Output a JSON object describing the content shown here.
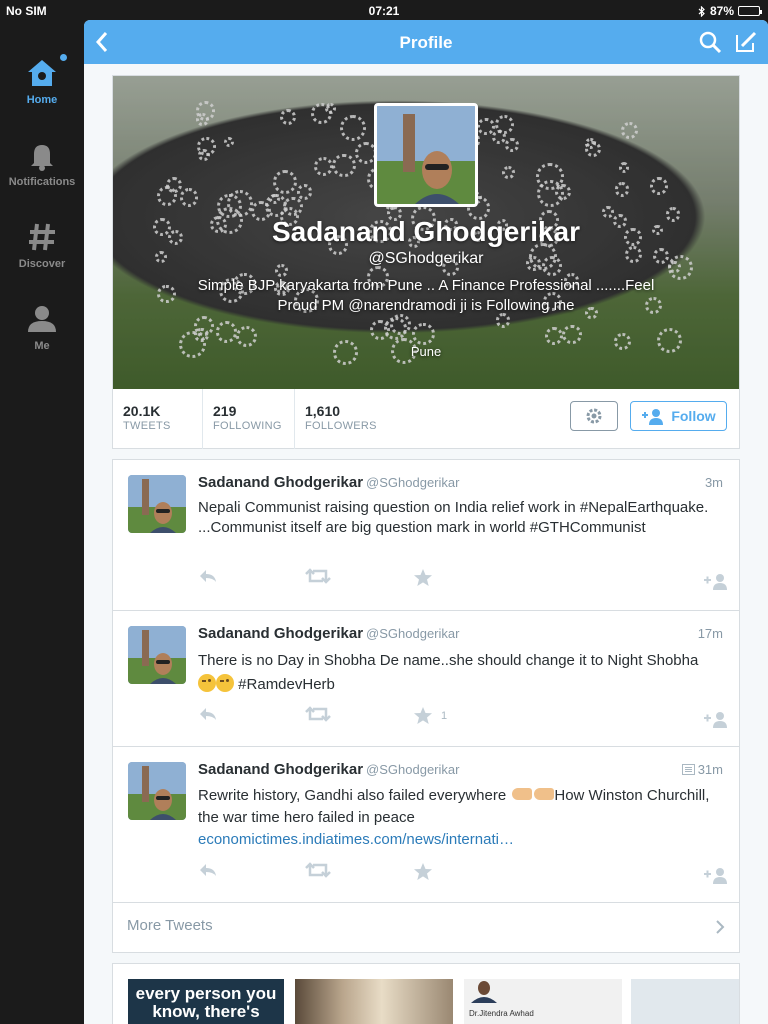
{
  "status_bar": {
    "carrier": "No SIM",
    "time": "07:21",
    "battery": "87%",
    "battery_level": 0.87
  },
  "sidebar": {
    "items": [
      {
        "label": "Home",
        "icon": "home-icon",
        "active": true
      },
      {
        "label": "Notifications",
        "icon": "bell-icon",
        "active": false
      },
      {
        "label": "Discover",
        "icon": "hashtag-icon",
        "active": false
      },
      {
        "label": "Me",
        "icon": "person-icon",
        "active": false
      }
    ]
  },
  "navbar": {
    "title": "Profile"
  },
  "profile": {
    "name": "Sadanand Ghodgerikar",
    "handle": "@SGhodgerikar",
    "bio": "Simple BJP karyakarta from Pune .. A Finance Professional .......Feel Proud PM @narendramodi ji is Following me",
    "location": "Pune",
    "stats": [
      {
        "value": "20.1K",
        "label": "TWEETS"
      },
      {
        "value": "219",
        "label": "FOLLOWING"
      },
      {
        "value": "1,610",
        "label": "FOLLOWERS"
      }
    ],
    "follow_label": "Follow"
  },
  "tweets": [
    {
      "name": "Sadanand Ghodgerikar",
      "handle": "@SGhodgerikar",
      "time": "3m",
      "text": "Nepali Communist raising question on India relief work in #NepalEarthquake. ...Communist itself are big question mark in world #GTHCommunist",
      "favorites": ""
    },
    {
      "name": "Sadanand Ghodgerikar",
      "handle": "@SGhodgerikar",
      "time": "17m",
      "text_before": "There is no Day in Shobha De name..she should change it to Night Shobha",
      "text_after": "#RamdevHerb",
      "favorites": "1"
    },
    {
      "name": "Sadanand Ghodgerikar",
      "handle": "@SGhodgerikar",
      "time": "31m",
      "text_before": "Rewrite history, Gandhi also failed everywhere",
      "text_after": "How Winston Churchill, the war time hero failed in peace",
      "link": "economictimes.indiatimes.com/news/internati…",
      "favorites": ""
    }
  ],
  "more_tweets_label": "More Tweets",
  "media": {
    "thumb1_text": "every person you know, there's",
    "thumb3_text": "Dr.Jitendra Awhad"
  },
  "colors": {
    "accent": "#55acee",
    "sidebar_bg": "#1b1b1b",
    "text": "#292f33",
    "muted": "#8899a6"
  }
}
